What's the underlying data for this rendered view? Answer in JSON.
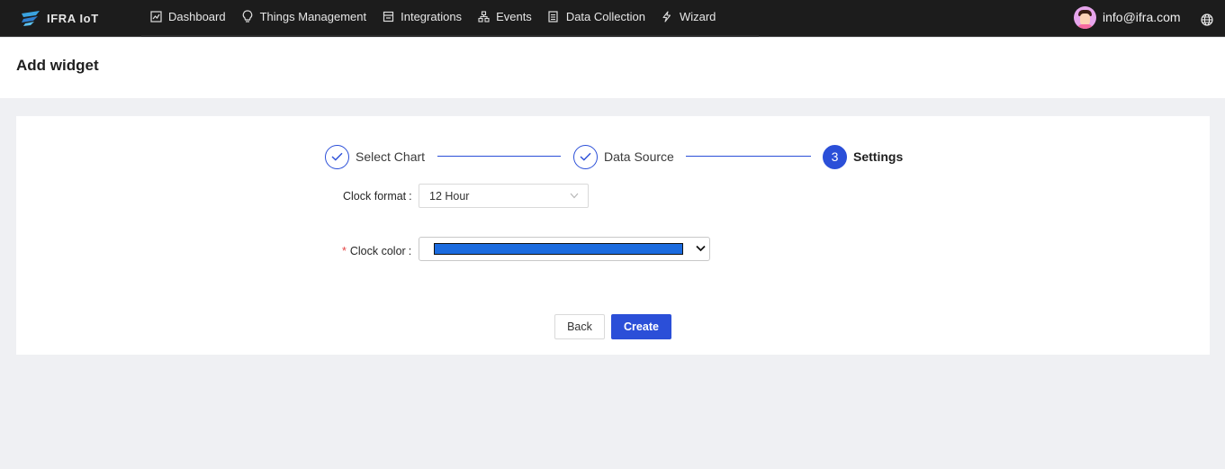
{
  "app": {
    "brand": "IFRA IoT",
    "nav": [
      {
        "label": "Dashboard",
        "icon": "dashboard-icon"
      },
      {
        "label": "Things Management",
        "icon": "bulb-icon"
      },
      {
        "label": "Integrations",
        "icon": "integrations-icon"
      },
      {
        "label": "Events",
        "icon": "events-icon"
      },
      {
        "label": "Data Collection",
        "icon": "document-icon"
      },
      {
        "label": "Wizard",
        "icon": "lightning-icon"
      }
    ],
    "user_email": "info@ifra.com"
  },
  "page": {
    "title": "Add widget"
  },
  "steps": [
    {
      "label": "Select Chart",
      "status": "done"
    },
    {
      "label": "Data Source",
      "status": "done"
    },
    {
      "label": "Settings",
      "status": "active",
      "number": "3"
    }
  ],
  "form": {
    "clock_format_label": "Clock format",
    "clock_format_value": "12 Hour",
    "clock_color_label": "Clock color",
    "clock_color_required": "*",
    "clock_color_value": "#1b6bdf",
    "colon": ":"
  },
  "buttons": {
    "back": "Back",
    "create": "Create"
  },
  "colors": {
    "primary": "#2b4fd8",
    "topbar": "#1c1c1c",
    "background": "#eff0f3"
  }
}
